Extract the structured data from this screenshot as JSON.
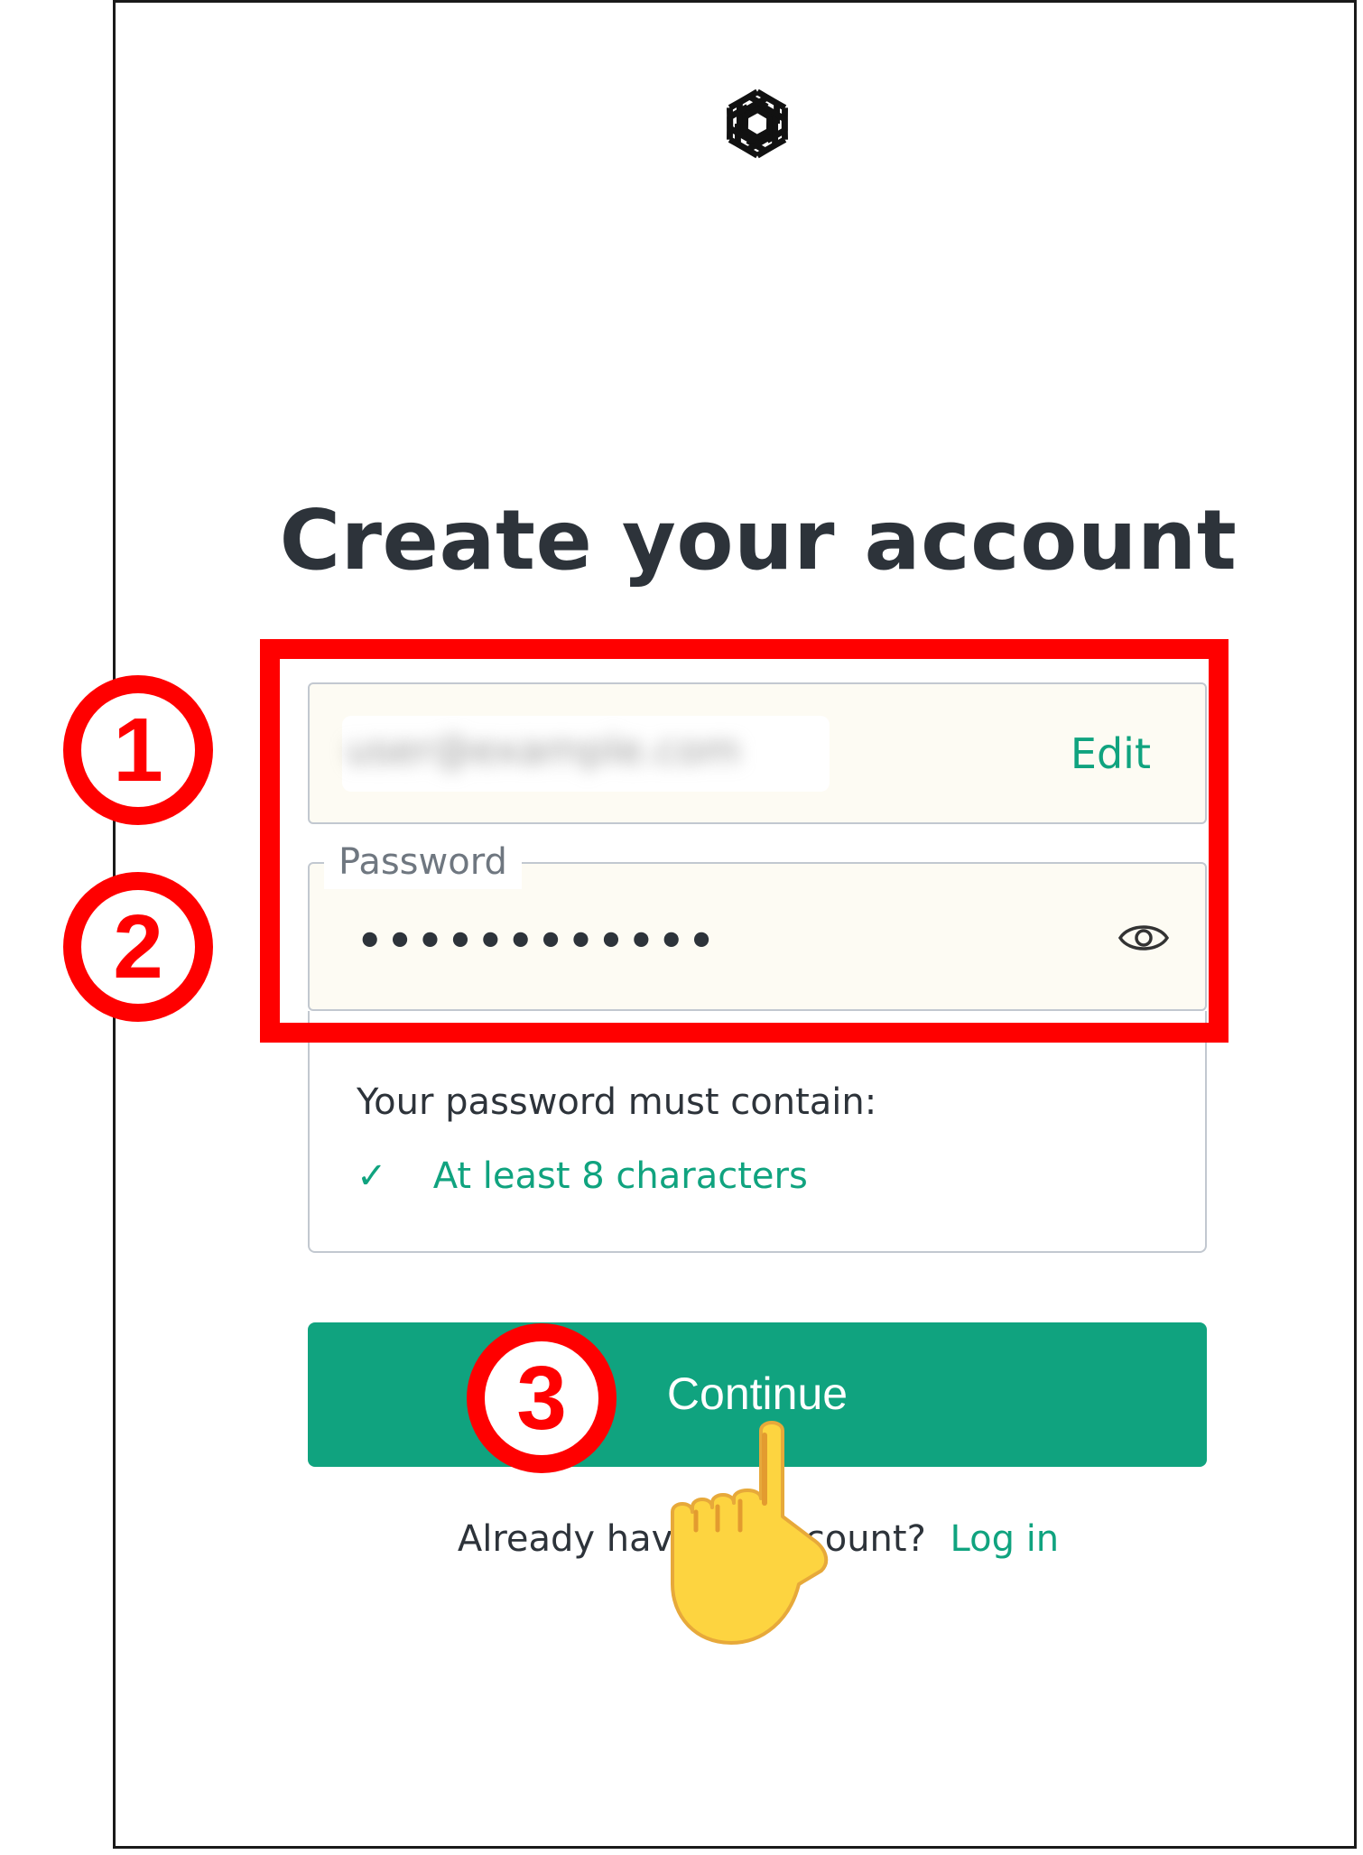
{
  "header": {
    "logo": "openai-logo-icon"
  },
  "page": {
    "title": "Create your account"
  },
  "email": {
    "value": "user@example.com",
    "edit_label": "Edit"
  },
  "password": {
    "label": "Password",
    "value": "••••••••••••",
    "toggle_icon": "eye-icon"
  },
  "requirements": {
    "title": "Your password must contain:",
    "items": [
      {
        "icon": "check-icon",
        "symbol": "✓",
        "label": "At least 8 characters"
      }
    ]
  },
  "actions": {
    "continue_label": "Continue"
  },
  "footer": {
    "prompt": "Already have an account?",
    "login_label": "Log in"
  },
  "annotations": {
    "step1": "1",
    "step2": "2",
    "step3": "3",
    "pointer_icon": "pointing-hand-icon"
  },
  "colors": {
    "accent": "#10a37f",
    "highlight": "#ff0000",
    "heading": "#2d333a",
    "field_bg": "#fdfbf3"
  }
}
